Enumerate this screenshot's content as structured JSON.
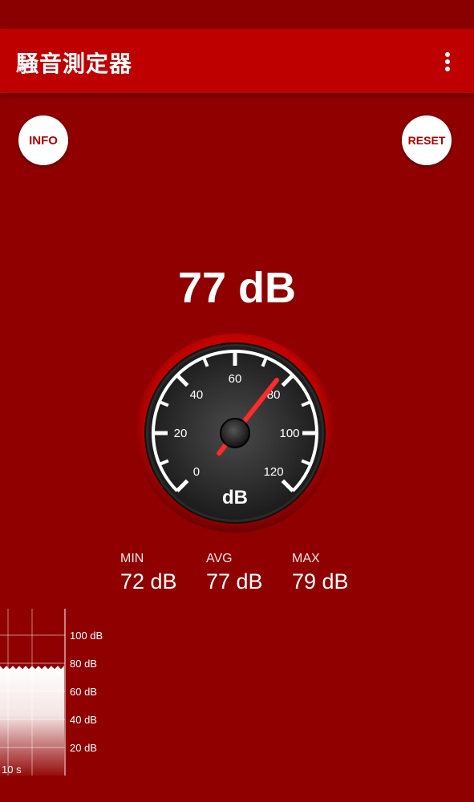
{
  "app": {
    "title": "騒音測定器"
  },
  "buttons": {
    "info": "INFO",
    "reset": "RESET"
  },
  "reading": {
    "current": "77 dB",
    "value_db": 77
  },
  "gauge": {
    "unit": "dB",
    "min": 0,
    "max": 120,
    "labels": [
      "0",
      "20",
      "40",
      "60",
      "80",
      "100",
      "120"
    ],
    "needle_value_db": 77
  },
  "stats": [
    {
      "label": "MIN",
      "value": "72 dB"
    },
    {
      "label": "AVG",
      "value": "77 dB"
    },
    {
      "label": "MAX",
      "value": "79 dB"
    }
  ],
  "history": {
    "y_labels": [
      "100 dB",
      "80 dB",
      "60 dB",
      "40 dB",
      "20 dB"
    ],
    "time_label": "10 s",
    "level_db": 77
  },
  "colors": {
    "background": "#900000",
    "appbar": "#bf0000",
    "accent": "#e00000",
    "needle": "#ff2a2a"
  }
}
